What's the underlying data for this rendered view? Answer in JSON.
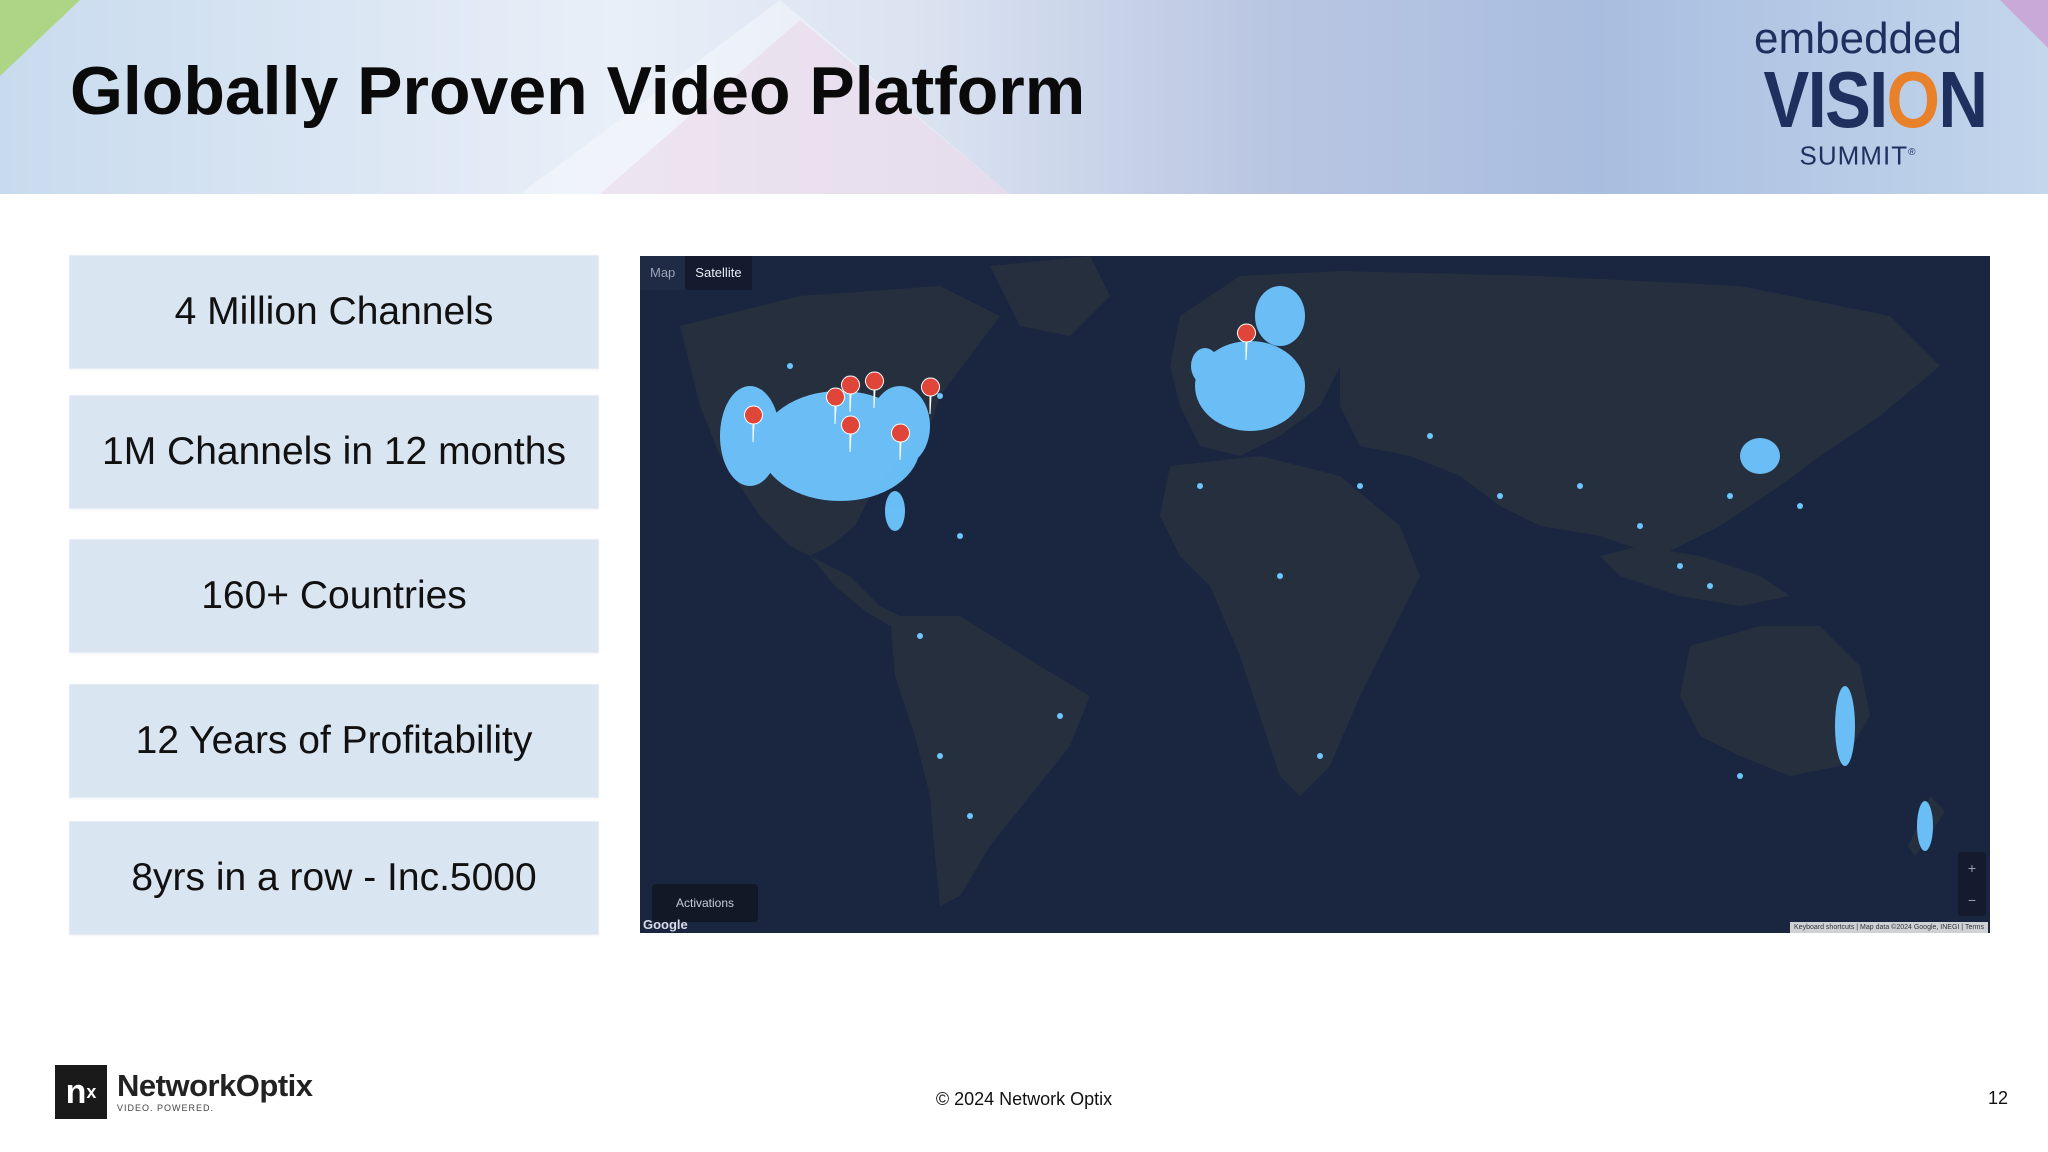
{
  "slide": {
    "title": "Globally Proven Video Platform",
    "page_number": "12",
    "copyright": "© 2024 Network Optix"
  },
  "event_logo": {
    "line1": "embedded",
    "line2_pre": "VISI",
    "line2_o": "O",
    "line2_post": "N",
    "line3": "SUMMIT",
    "registered": "®"
  },
  "company_logo": {
    "mark": "n",
    "mark_sup": "x",
    "name": "NetworkOptix",
    "tagline": "VIDEO. POWERED."
  },
  "stats": [
    "4 Million Channels",
    "1M Channels in 12 months",
    "160+ Countries",
    "12 Years of Profitability",
    "8yrs in a row - Inc.5000"
  ],
  "map": {
    "tabs": [
      {
        "label": "Map",
        "active": false
      },
      {
        "label": "Satellite",
        "active": true
      }
    ],
    "activations_label": "Activations",
    "provider": "Google",
    "attribution": "Keyboard shortcuts | Map data ©2024 Google, INEGI | Terms",
    "zoom_in": "+",
    "zoom_out": "−",
    "colors": {
      "ocean": "#1a2540",
      "land": "#262f3e",
      "dots": "#6ec6ff",
      "pins": "#e0453a"
    }
  }
}
